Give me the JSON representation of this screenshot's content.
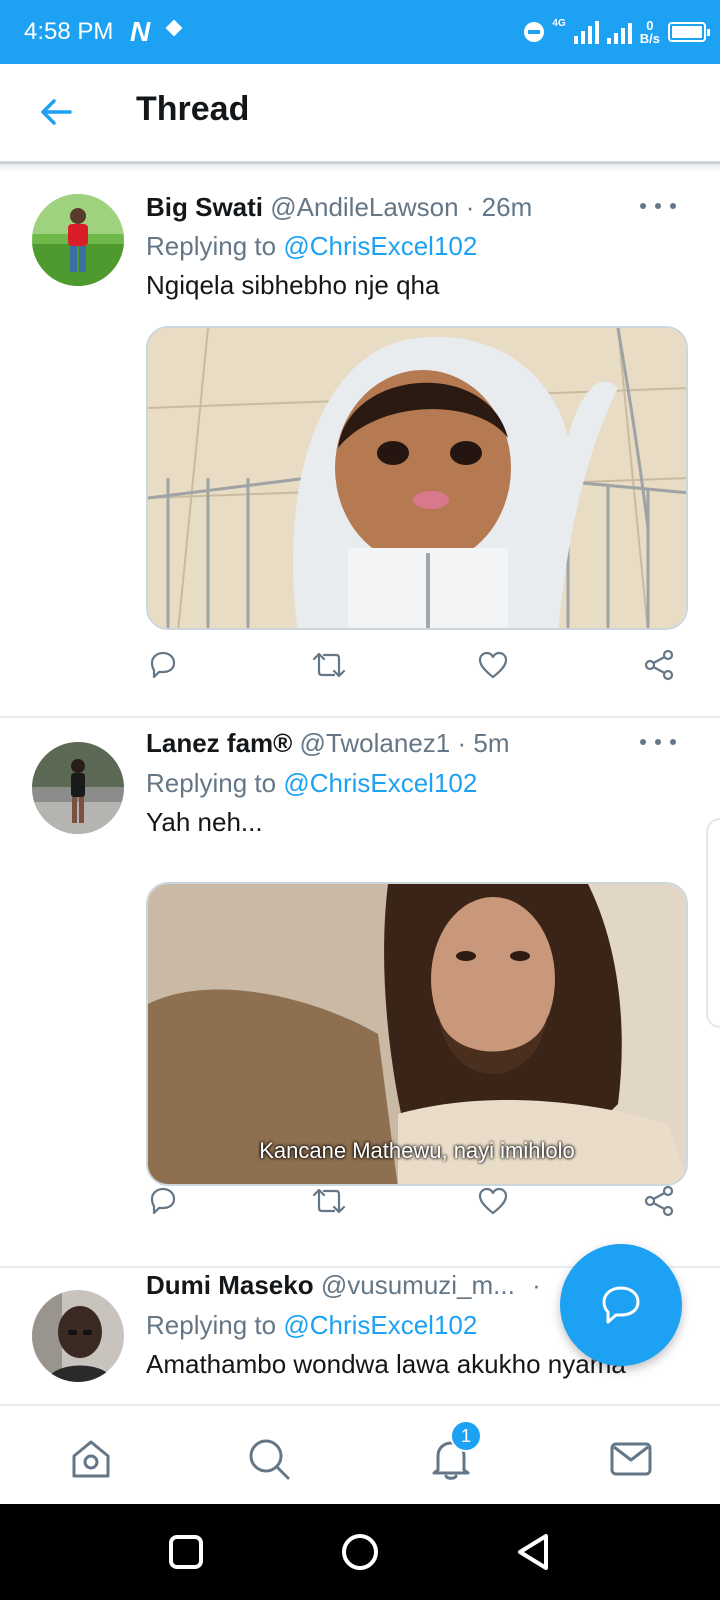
{
  "status_bar": {
    "time": "4:58 PM",
    "notification_icon": "N",
    "network_type": "4G",
    "speed_value": "0",
    "speed_unit": "B/s"
  },
  "header": {
    "title": "Thread",
    "back_icon": "arrow-left-icon"
  },
  "tweets": [
    {
      "name": "Big Swati",
      "handle": "@AndileLawson",
      "time": "· 26m",
      "replying_prefix": "Replying to ",
      "replying_to": "@ChrisExcel102",
      "text": "Ngiqela sibhebho nje qha",
      "media_caption": ""
    },
    {
      "name": "Lanez fam®",
      "handle": "@Twolanez1",
      "time": "· 5m",
      "replying_prefix": "Replying to ",
      "replying_to": "@ChrisExcel102",
      "text": "Yah neh...",
      "media_caption": "Kancane Mathewu, nayi imihlolo"
    },
    {
      "name": "Dumi Maseko",
      "handle": "@vusumuzi_m...",
      "time": "·",
      "replying_prefix": "Replying to ",
      "replying_to": "@ChrisExcel102",
      "text": "Amathambo wondwa lawa akukho nyama"
    }
  ],
  "action_icons": [
    "reply-icon",
    "retweet-icon",
    "like-icon",
    "share-icon"
  ],
  "bottom_nav": {
    "items": [
      "home-icon",
      "search-icon",
      "notifications-icon",
      "messages-icon"
    ],
    "notification_count": "1"
  },
  "colors": {
    "accent": "#1da1f2",
    "text_primary": "#14171a",
    "text_secondary": "#657786"
  }
}
